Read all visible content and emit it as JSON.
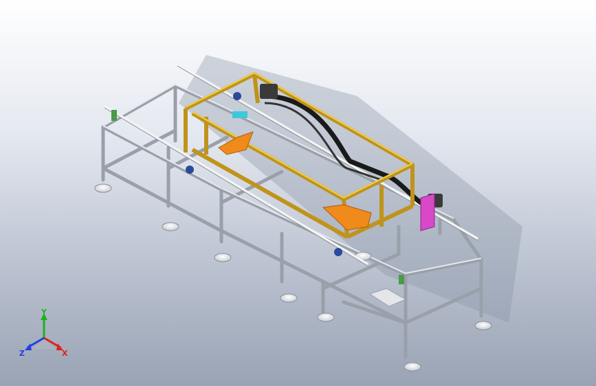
{
  "viewport": {
    "background_top": "#ffffff",
    "background_bottom": "#9aa3b4"
  },
  "model": {
    "frame_color": "#c9ccd2",
    "gantry_color": "#e8b62c",
    "orange_part_color": "#f08a1a",
    "motor_color": "#3a3a3a",
    "belt_color": "#1a1a1a",
    "bracket_color": "#d848c8",
    "bearing_color": "#2a4a9a",
    "green_part_color": "#4a9a4a"
  },
  "triad": {
    "x_label": "X",
    "y_label": "Y",
    "z_label": "Z",
    "x_color": "#e02020",
    "y_color": "#20b020",
    "z_color": "#2040e0"
  }
}
